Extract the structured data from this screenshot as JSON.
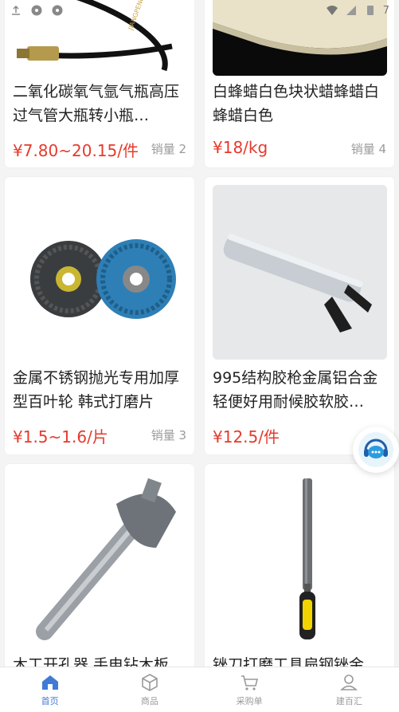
{
  "status_bar": {
    "time": "7",
    "left_icons": [
      "upload-icon",
      "gps-icon",
      "gps-icon"
    ],
    "right_icons": [
      "wifi-icon",
      "signal-icon",
      "battery-icon"
    ]
  },
  "products": [
    {
      "title": "二氧化碳氧气氩气瓶高压过气管大瓶转小瓶…",
      "price": "¥7.80~20.15/件",
      "sales": "销量 2"
    },
    {
      "title": "白蜂蜡白色块状蜡蜂蜡白蜂蜡白色",
      "price": "¥18/kg",
      "sales": "销量 4"
    },
    {
      "title": "金属不锈钢抛光专用加厚型百叶轮 韩式打磨片",
      "price": "¥1.5~1.6/片",
      "sales": "销量 3"
    },
    {
      "title": "995结构胶枪金属铝合金轻便好用耐候胶软胶…",
      "price": "¥12.5/件",
      "sales": "销"
    },
    {
      "title": "木工开孔器 手电钻木板",
      "price": "",
      "sales": ""
    },
    {
      "title": "锉刀打磨工具扁钢锉金",
      "price": "",
      "sales": ""
    }
  ],
  "float_service": {
    "icon": "customer-service-icon"
  },
  "bottom_nav": [
    {
      "label": "首页",
      "icon": "home-icon",
      "active": true
    },
    {
      "label": "商品",
      "icon": "box-icon",
      "active": false
    },
    {
      "label": "采购单",
      "icon": "cart-icon",
      "active": false
    },
    {
      "label": "建百汇",
      "icon": "user-icon",
      "active": false
    }
  ],
  "colors": {
    "price": "#e7392c",
    "accent": "#3f7bd6"
  }
}
